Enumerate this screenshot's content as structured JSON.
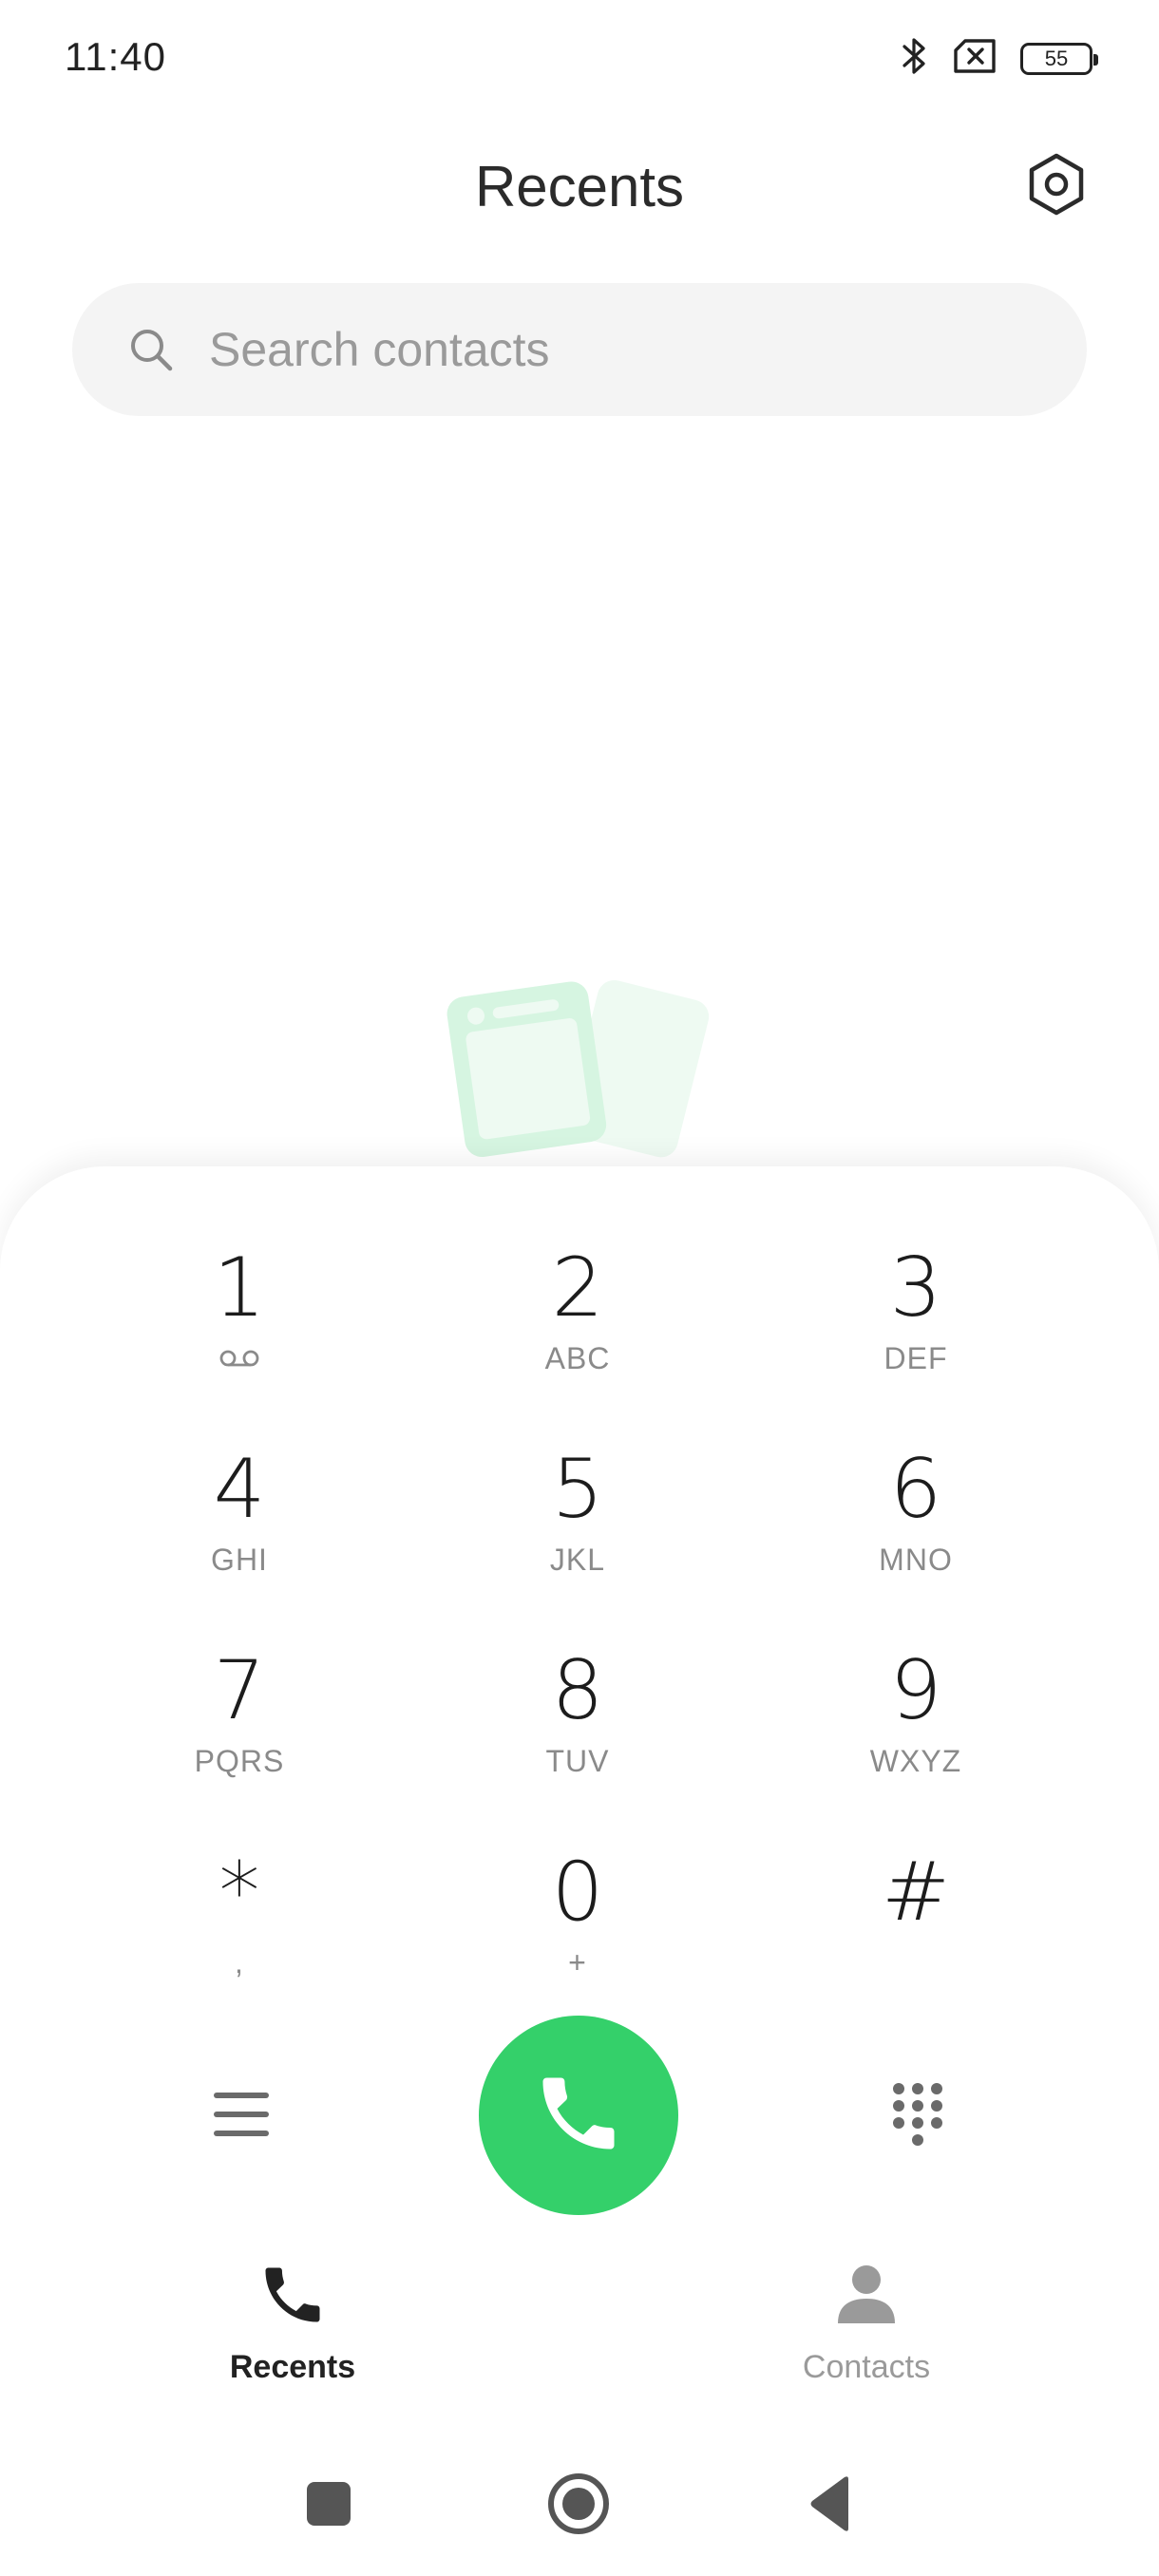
{
  "status_bar": {
    "time": "11:40",
    "battery_level": "55",
    "icons": [
      "bluetooth-icon",
      "no-sim-icon",
      "battery-icon"
    ]
  },
  "header": {
    "title": "Recents",
    "settings_icon": "settings-hexagon-icon"
  },
  "search": {
    "placeholder": "Search contacts",
    "icon": "search-icon"
  },
  "dialpad": {
    "keys": [
      {
        "digit": "1",
        "letters": "",
        "voicemail": true
      },
      {
        "digit": "2",
        "letters": "ABC"
      },
      {
        "digit": "3",
        "letters": "DEF"
      },
      {
        "digit": "4",
        "letters": "GHI"
      },
      {
        "digit": "5",
        "letters": "JKL"
      },
      {
        "digit": "6",
        "letters": "MNO"
      },
      {
        "digit": "7",
        "letters": "PQRS"
      },
      {
        "digit": "8",
        "letters": "TUV"
      },
      {
        "digit": "9",
        "letters": "WXYZ"
      },
      {
        "digit": "*",
        "letters": ","
      },
      {
        "digit": "0",
        "letters": "+"
      },
      {
        "digit": "#",
        "letters": ""
      }
    ],
    "actions": {
      "menu_icon": "menu-icon",
      "call_icon": "phone-icon",
      "keypad_icon": "dialpad-grid-icon"
    }
  },
  "tabs": [
    {
      "label": "Recents",
      "icon": "phone-icon",
      "active": true
    },
    {
      "label": "Contacts",
      "icon": "person-icon",
      "active": false
    }
  ],
  "nav_bar": {
    "buttons": [
      "recents-square-icon",
      "home-circle-icon",
      "back-triangle-icon"
    ]
  },
  "colors": {
    "call_green": "#34d06a",
    "illustration_green": "#d6f5e1",
    "active_tab": "#222222",
    "inactive_tab": "#9a9a9a"
  }
}
